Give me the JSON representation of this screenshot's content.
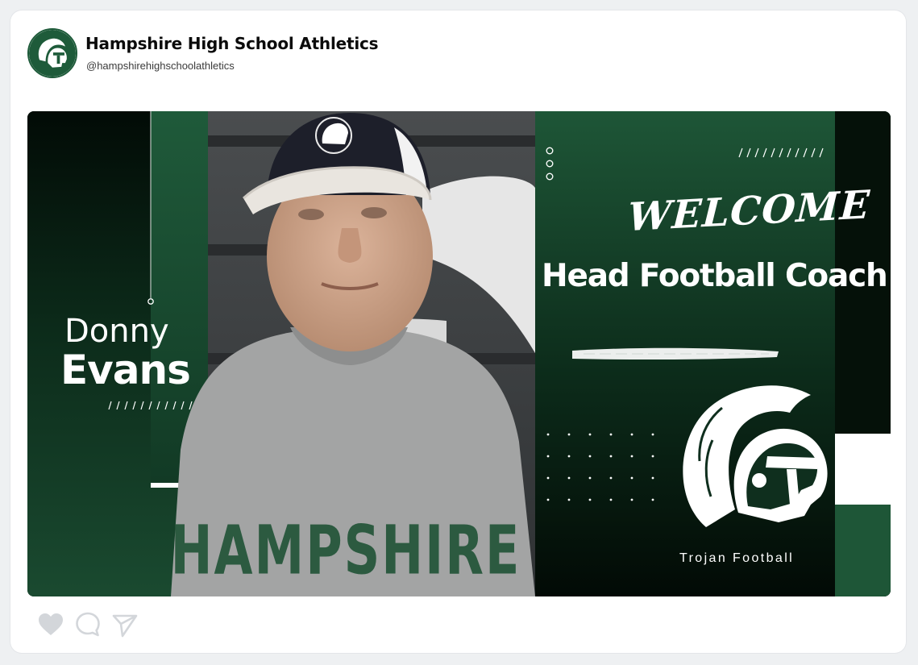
{
  "account": {
    "name": "Hampshire High School Athletics",
    "handle": "@hampshirehighschoolathletics"
  },
  "post": {
    "first_name": "Donny",
    "last_name": "Evans",
    "welcome": "WELCOME",
    "title": "Head Football Coach",
    "team": "Trojan Football",
    "shirt_text": "HAMPSHIRE"
  },
  "actions": {
    "like_icon": "heart-icon",
    "comment_icon": "comment-icon",
    "share_icon": "send-icon"
  },
  "colors": {
    "brand_green": "#1e5b3a",
    "dark_green": "#0a2a19",
    "white": "#ffffff",
    "icon_gray": "#d3d6da"
  }
}
